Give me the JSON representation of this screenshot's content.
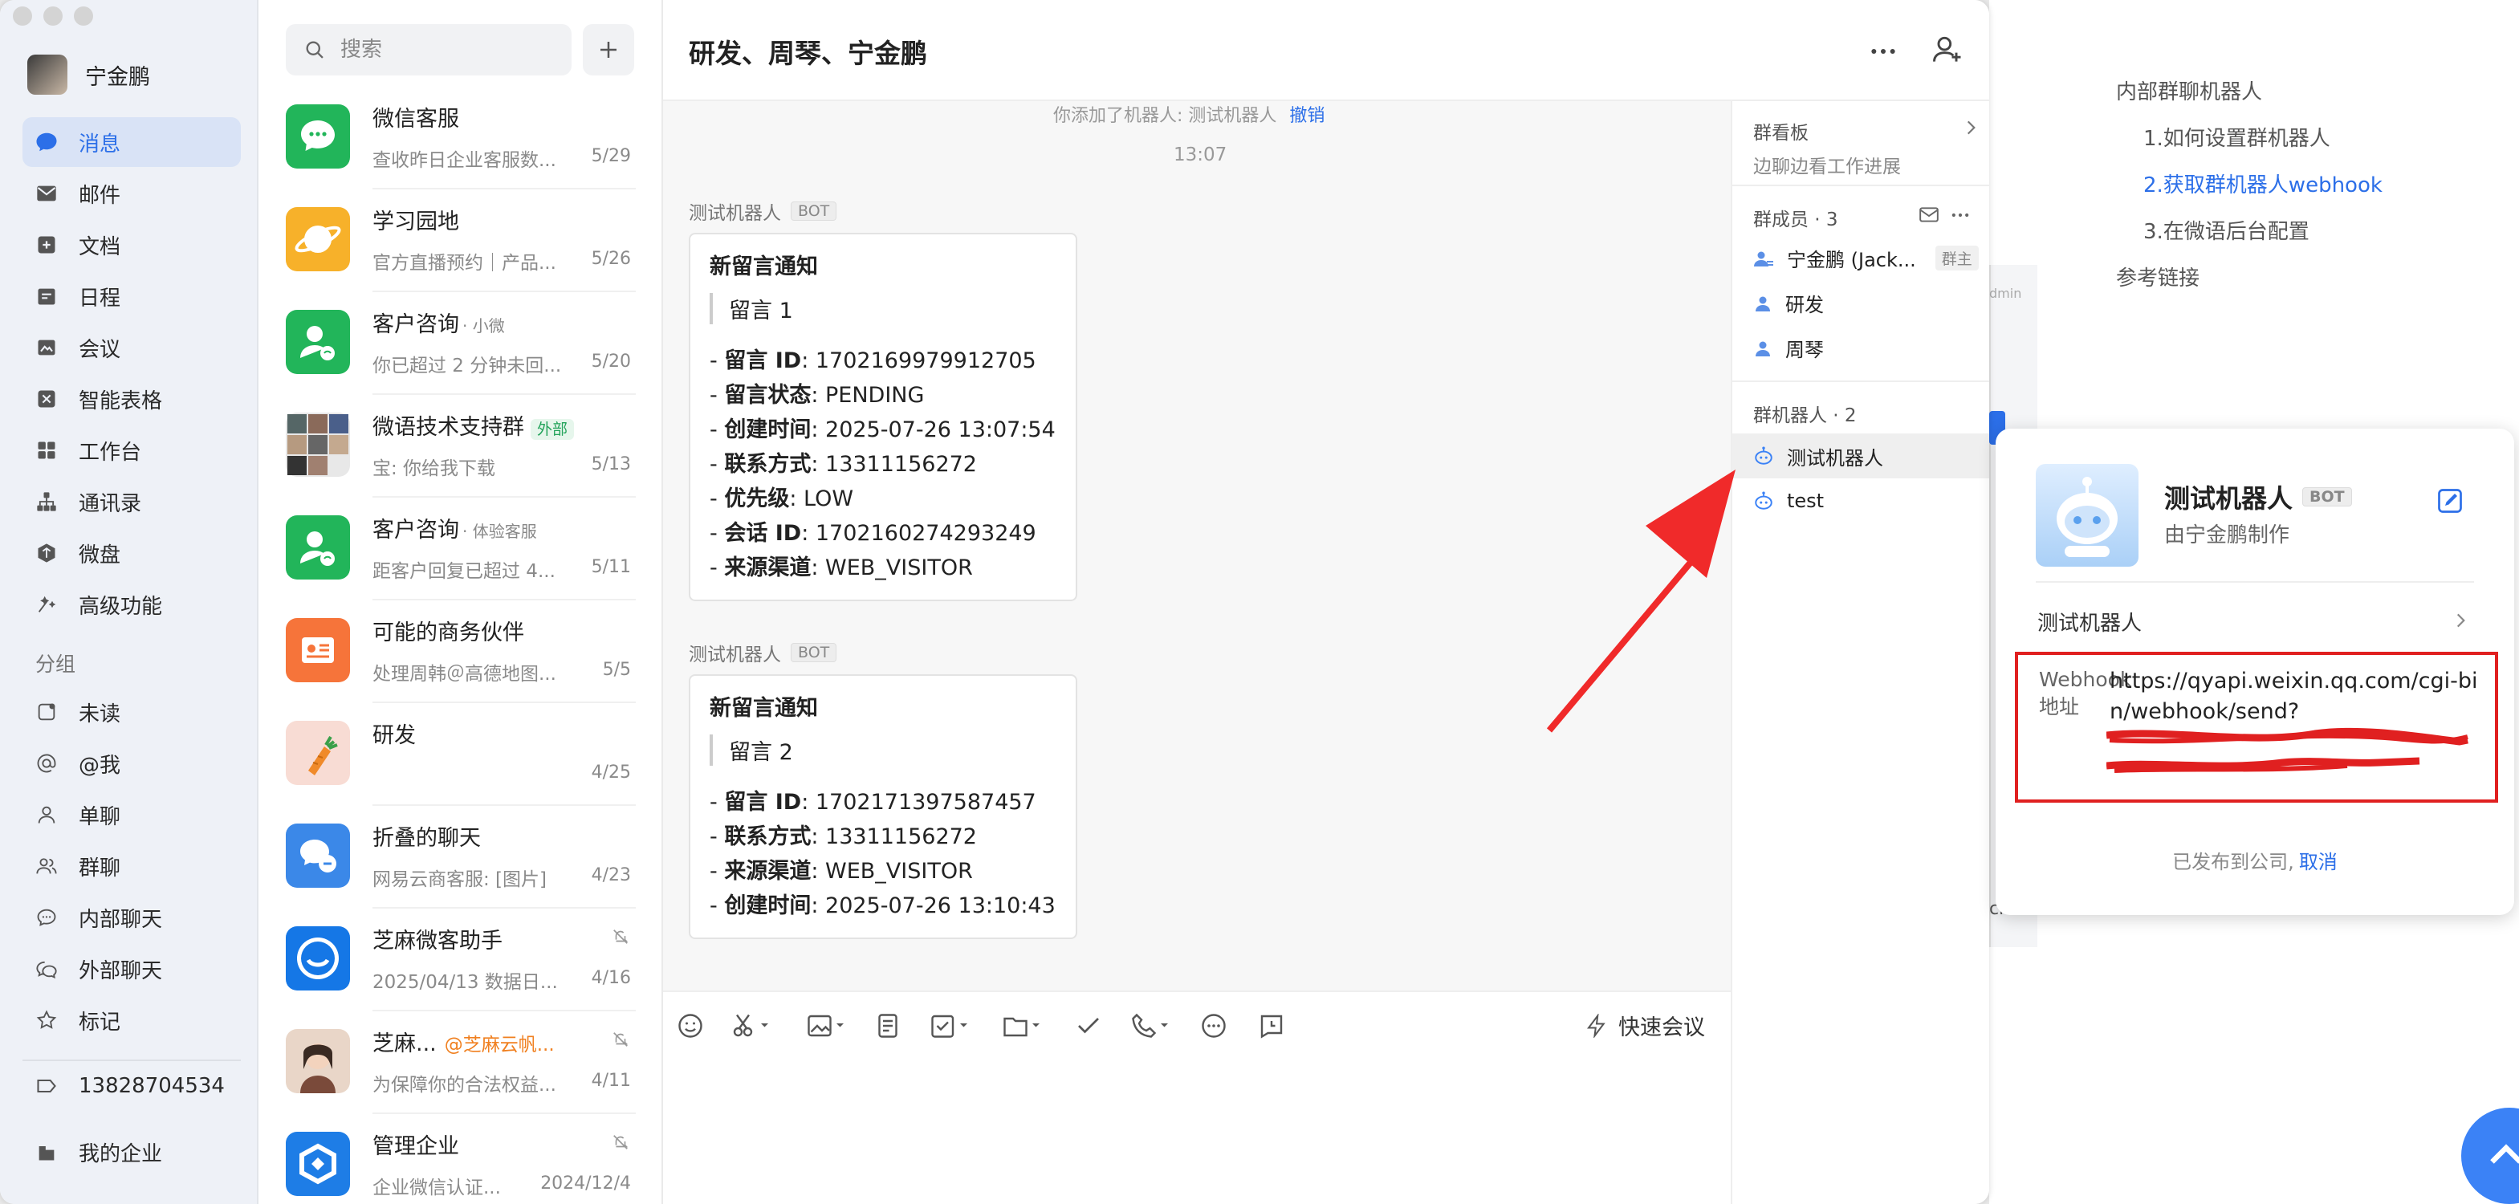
{
  "window": {
    "title": "研发、周琴、宁金鹏"
  },
  "sidebar": {
    "user_name": "宁金鹏",
    "nav": [
      {
        "label": "消息",
        "icon": "message-icon",
        "active": true
      },
      {
        "label": "邮件",
        "icon": "mail-icon"
      },
      {
        "label": "文档",
        "icon": "doc-icon"
      },
      {
        "label": "日程",
        "icon": "calendar-icon"
      },
      {
        "label": "会议",
        "icon": "meeting-icon"
      },
      {
        "label": "智能表格",
        "icon": "smart-table-icon"
      },
      {
        "label": "工作台",
        "icon": "workbench-icon"
      },
      {
        "label": "通讯录",
        "icon": "contacts-icon"
      },
      {
        "label": "微盘",
        "icon": "drive-icon"
      },
      {
        "label": "高级功能",
        "icon": "advanced-icon"
      }
    ],
    "group_label": "分组",
    "groups": [
      {
        "label": "未读",
        "icon": "unread-icon"
      },
      {
        "label": "@我",
        "icon": "mention-icon"
      },
      {
        "label": "单聊",
        "icon": "single-chat-icon"
      },
      {
        "label": "群聊",
        "icon": "group-chat-icon"
      },
      {
        "label": "内部聊天",
        "icon": "internal-chat-icon"
      },
      {
        "label": "外部聊天",
        "icon": "external-chat-icon"
      },
      {
        "label": "标记",
        "icon": "star-icon"
      }
    ],
    "phone": "13828704534",
    "my_company": "我的企业"
  },
  "search": {
    "placeholder": "搜索"
  },
  "chats": [
    {
      "title": "微信客服",
      "subtitle": "查收昨日企业客服数...",
      "date": "5/29"
    },
    {
      "title": "学习园地",
      "subtitle": "官方直播预约｜产品...",
      "date": "5/26"
    },
    {
      "title": "客户咨询",
      "tag": "· 小微",
      "subtitle": "你已超过 2 分钟未回...",
      "date": "5/20"
    },
    {
      "title": "微语技术支持群",
      "ext": "外部",
      "subtitle": "宝: 你给我下载",
      "date": "5/13"
    },
    {
      "title": "客户咨询",
      "tag": "· 体验客服",
      "subtitle": "距客户回复已超过 4...",
      "date": "5/11"
    },
    {
      "title": "可能的商务伙伴",
      "subtitle": "处理周韩＠高德地图...",
      "date": "5/5"
    },
    {
      "title": "研发",
      "subtitle": "",
      "date": "4/25"
    },
    {
      "title": "折叠的聊天",
      "subtitle": "网易云商客服: [图片]",
      "date": "4/23"
    },
    {
      "title": "芝麻微客助手",
      "subtitle": "2025/04/13 数据日...",
      "date": "4/16",
      "muted": true
    },
    {
      "title": "芝麻...",
      "mention": "@芝麻云帆...",
      "subtitle": "为保障你的合法权益...",
      "date": "4/11",
      "muted": true
    },
    {
      "title": "管理企业",
      "subtitle": "企业微信认证...",
      "date": "2024/12/4",
      "muted": true
    }
  ],
  "conversation": {
    "system_notice": "你添加了机器人: 测试机器人",
    "system_notice_action": "撤销",
    "time": "13:07",
    "messages": [
      {
        "sender": "测试机器人",
        "badge": "BOT",
        "title": "新留言通知",
        "quote": "留言 1",
        "lines": [
          {
            "k": "留言 ID",
            "v": "1702169979912705"
          },
          {
            "k": "留言状态",
            "v": "PENDING"
          },
          {
            "k": "创建时间",
            "v": "2025-07-26 13:07:54"
          },
          {
            "k": "联系方式",
            "v": "13311156272"
          },
          {
            "k": "优先级",
            "v": "LOW"
          },
          {
            "k": "会话 ID",
            "v": "1702160274293249"
          },
          {
            "k": "来源渠道",
            "v": "WEB_VISITOR"
          }
        ]
      },
      {
        "sender": "测试机器人",
        "badge": "BOT",
        "title": "新留言通知",
        "quote": "留言 2",
        "lines": [
          {
            "k": "留言 ID",
            "v": "1702171397587457"
          },
          {
            "k": "联系方式",
            "v": "13311156272"
          },
          {
            "k": "来源渠道",
            "v": "WEB_VISITOR"
          },
          {
            "k": "创建时间",
            "v": "2025-07-26 13:10:43"
          }
        ]
      }
    ],
    "toolbar": {
      "icons": [
        "emoji-icon",
        "scissors-icon",
        "image-icon",
        "note-icon",
        "todo-icon",
        "folder-icon",
        "check-icon",
        "phone-icon",
        "more-circle-icon",
        "schedule-icon"
      ],
      "quick_meeting": "快速会议"
    }
  },
  "group_panel": {
    "board_title": "群看板",
    "board_sub": "边聊边看工作进展",
    "members_title": "群成员 · 3",
    "members": [
      {
        "name": "宁金鹏 (Jack...",
        "tag": "群主"
      },
      {
        "name": "研发"
      },
      {
        "name": "周琴"
      }
    ],
    "robots_title": "群机器人 · 2",
    "robots": [
      {
        "name": "测试机器人",
        "selected": true
      },
      {
        "name": "test"
      }
    ]
  },
  "robot_popup": {
    "name": "测试机器人",
    "badge": "BOT",
    "maker": "由宁金鹏制作",
    "row_label": "测试机器人",
    "webhook_label": "Webhook 地址",
    "webhook_url": "https://qyapi.weixin.qq.com/cgi-bin/webhook/send?",
    "publish_text": "已发布到公司,",
    "cancel": "取消"
  },
  "background_doc": {
    "toc": [
      {
        "label": "内部群聊机器人",
        "level": 1
      },
      {
        "label": "1.如何设置群机器人",
        "level": 2
      },
      {
        "label": "2.获取群机器人webhook",
        "level": 2,
        "active": true
      },
      {
        "label": "3.在微语后台配置",
        "level": 2
      },
      {
        "label": "参考链接",
        "level": 1
      }
    ],
    "fragment_admin": "dmin",
    "fragment_ch": "ch"
  },
  "colors": {
    "accent": "#2c6fe8",
    "highlight_red": "#e02020",
    "wecom_green": "#22b55a"
  }
}
